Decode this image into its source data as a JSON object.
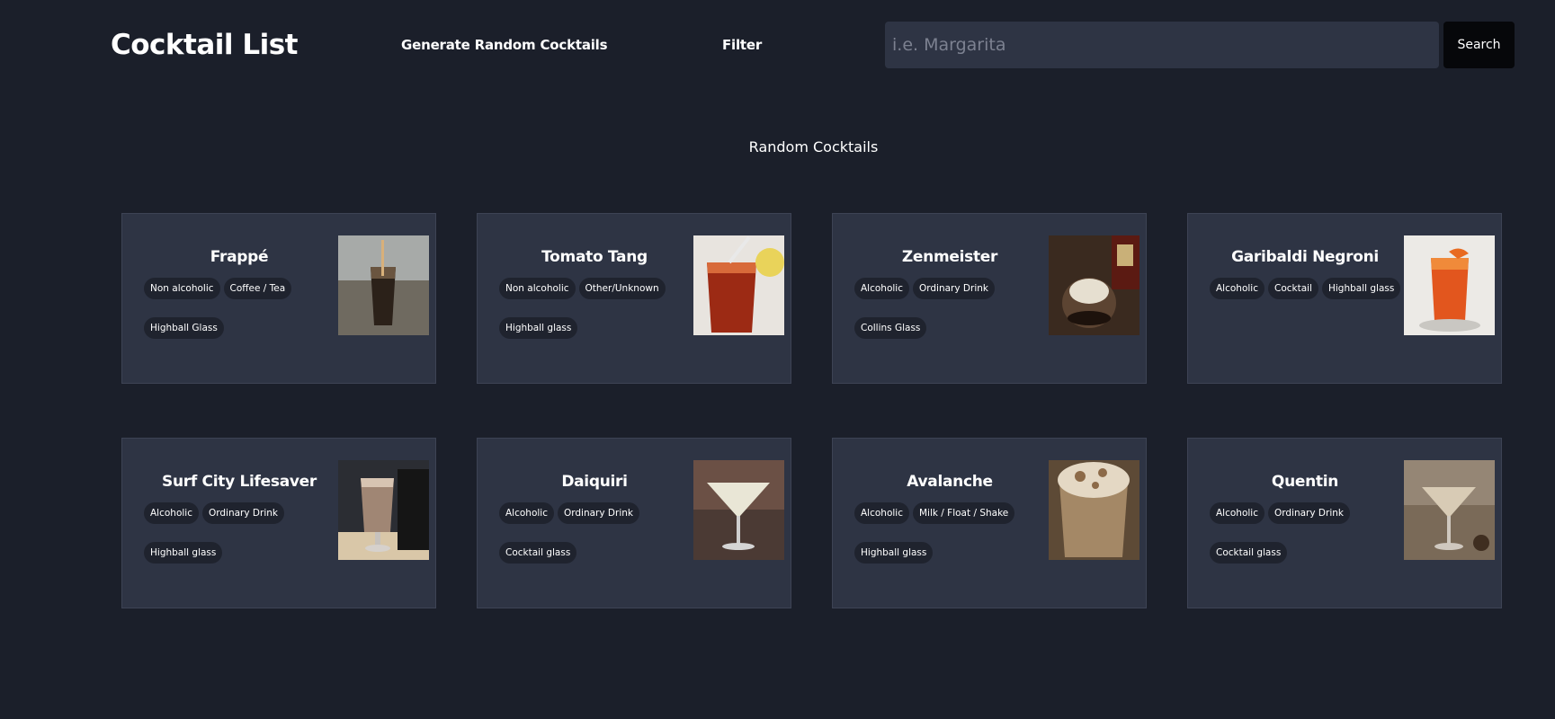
{
  "header": {
    "brand": "Cocktail List",
    "nav_random": "Generate Random Cocktails",
    "nav_filter": "Filter",
    "search_placeholder": "i.e. Margarita",
    "search_button": "Search"
  },
  "section": {
    "title": "Random Cocktails"
  },
  "cocktails": [
    {
      "name": "Frappé",
      "tags": [
        "Non alcoholic",
        "Coffee / Tea",
        "Highball Glass"
      ],
      "image": "frappe-photo"
    },
    {
      "name": "Tomato Tang",
      "tags": [
        "Non alcoholic",
        "Other/Unknown",
        "Highball glass"
      ],
      "image": "tomato-tang-photo"
    },
    {
      "name": "Zenmeister",
      "tags": [
        "Alcoholic",
        "Ordinary Drink",
        "Collins Glass"
      ],
      "image": "zenmeister-photo"
    },
    {
      "name": "Garibaldi Negroni",
      "tags": [
        "Alcoholic",
        "Cocktail",
        "Highball glass"
      ],
      "image": "garibaldi-negroni-photo"
    },
    {
      "name": "Surf City Lifesaver",
      "tags": [
        "Alcoholic",
        "Ordinary Drink",
        "Highball glass"
      ],
      "image": "surf-city-lifesaver-photo"
    },
    {
      "name": "Daiquiri",
      "tags": [
        "Alcoholic",
        "Ordinary Drink",
        "Cocktail glass"
      ],
      "image": "daiquiri-photo"
    },
    {
      "name": "Avalanche",
      "tags": [
        "Alcoholic",
        "Milk / Float / Shake",
        "Highball glass"
      ],
      "image": "avalanche-photo"
    },
    {
      "name": "Quentin",
      "tags": [
        "Alcoholic",
        "Ordinary Drink",
        "Cocktail glass"
      ],
      "image": "quentin-photo"
    }
  ]
}
